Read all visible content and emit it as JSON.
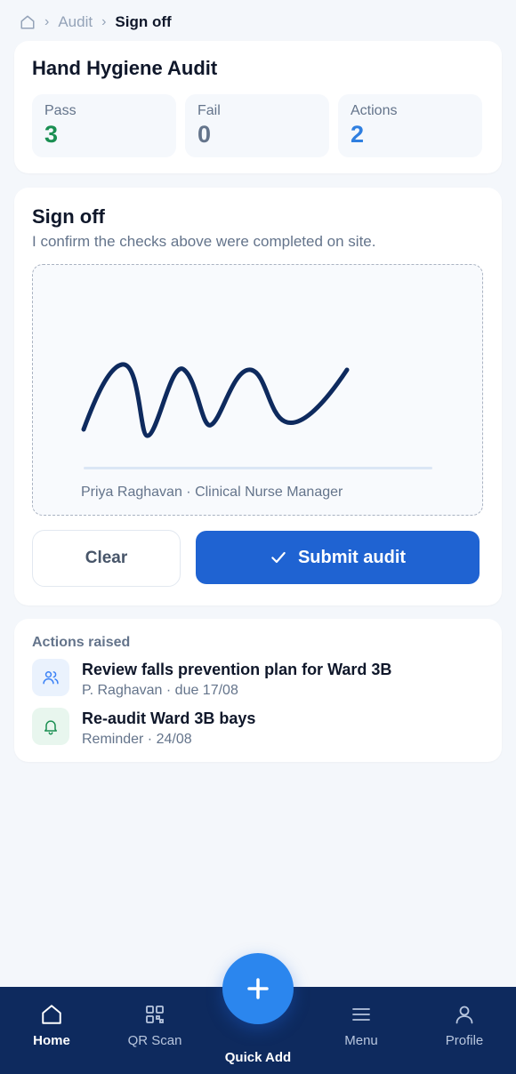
{
  "breadcrumb": {
    "items": [
      "Audit",
      "Sign off"
    ]
  },
  "audit": {
    "title": "Hand Hygiene Audit",
    "stats": [
      {
        "label": "Pass",
        "value": "3",
        "color": "#1a8f52"
      },
      {
        "label": "Fail",
        "value": "0",
        "color": "#64748b"
      },
      {
        "label": "Actions",
        "value": "2",
        "color": "#2f7fe0"
      }
    ]
  },
  "signoff": {
    "title": "Sign off",
    "description": "I confirm the checks above were completed on site.",
    "signer": "Priya Raghavan · Clinical Nurse Manager",
    "clear_label": "Clear",
    "submit_label": "Submit audit"
  },
  "actions": {
    "title": "Actions raised",
    "items": [
      {
        "title": "Review falls prevention plan for Ward 3B",
        "subtitle": "P. Raghavan · due 17/08",
        "icon": "users-icon"
      },
      {
        "title": "Re-audit Ward 3B bays",
        "subtitle": "Reminder · 24/08",
        "icon": "bell-icon"
      }
    ]
  },
  "nav": {
    "items": [
      {
        "label": "Home",
        "icon": "home-icon",
        "active": true
      },
      {
        "label": "QR Scan",
        "icon": "qr-icon"
      },
      {
        "label": "Menu",
        "icon": "menu-icon"
      },
      {
        "label": "Profile",
        "icon": "profile-icon"
      }
    ],
    "fab_label": "Quick Add"
  },
  "colors": {
    "primary": "#1f63d2",
    "navbar": "#0e2a5e",
    "fab": "#2b86ee",
    "signature": "#0e2a5e"
  }
}
